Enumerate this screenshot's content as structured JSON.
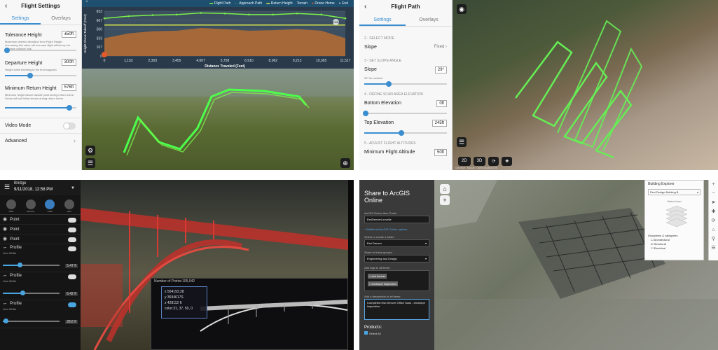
{
  "flight_settings": {
    "title": "Flight Settings",
    "tabs": [
      "Settings",
      "Overlays"
    ],
    "tolerance": {
      "label": "Tolerance Height",
      "value": "±50ft",
      "desc": "Maximum desired deviation from Flight Height. Increasing this value will increase flight efficiency but increase collision risk.",
      "level": 0.03
    },
    "departure": {
      "label": "Departure Height",
      "value": "300ft",
      "desc": "Height while traveling to the first waypoint.",
      "level": 0.35
    },
    "min_return": {
      "label": "Minimum Return Height",
      "value": "576ft",
      "desc": "Minimum height above takeoff point during return home. Drone will not follow terrain during return home.",
      "level": 0.9
    },
    "video_mode": {
      "label": "Video Mode",
      "on": false
    },
    "advanced": {
      "label": "Advanced"
    },
    "chart_legend": [
      "Flight Path",
      "Approach Path",
      "Return Height",
      "Terrain",
      "Drone Home",
      "End"
    ],
    "ylabel": "Height Above Takeoff (Feet)",
    "xlabel": "Distance Traveled (Feet)",
    "end_badge": "END"
  },
  "chart_data": {
    "type": "area",
    "x": [
      0,
      1152,
      2303,
      3455,
      4607,
      5758,
      6910,
      8062,
      9213,
      10365,
      11517
    ],
    "xticks": [
      "0",
      "1,152",
      "2,303",
      "3,455",
      "4,607",
      "5,758",
      "6,910",
      "8,062",
      "9,213",
      "10,365",
      "11,517"
    ],
    "yticks": [
      "833",
      "667",
      "500",
      "333",
      "167",
      "0"
    ],
    "ylim": [
      0,
      833
    ],
    "series": [
      {
        "name": "Terrain",
        "values": [
          330,
          420,
          460,
          470,
          520,
          500,
          470,
          480,
          500,
          470,
          330
        ]
      },
      {
        "name": "Flight Path",
        "values": [
          700,
          740,
          760,
          770,
          800,
          790,
          770,
          770,
          790,
          770,
          700
        ]
      },
      {
        "name": "Return Height",
        "values": [
          576,
          576,
          576,
          576,
          576,
          576,
          576,
          576,
          576,
          576,
          576
        ]
      }
    ],
    "xlabel": "Distance Traveled (Feet)",
    "ylabel": "Height Above Takeoff (Feet)"
  },
  "flight_path": {
    "title": "Flight Path",
    "tabs": [
      "Settings",
      "Overlays"
    ],
    "sec2": "2 - SELECT MODE",
    "slope_mode": {
      "label": "Slope",
      "value": "Fixed"
    },
    "sec3": "3 - SET SLOPE ANGLE",
    "slope_angle": {
      "label": "Slope",
      "value": "29°",
      "desc": "90° for vertical",
      "level": 0.3
    },
    "sec4": "4 - DEFINE SCAN AREA ELEVATION",
    "bottom_elev": {
      "label": "Bottom Elevation",
      "value": "0ft",
      "level": 0.02
    },
    "top_elev": {
      "label": "Top Elevation",
      "value": "245ft",
      "level": 0.45
    },
    "sec5": "5 - ADJUST FLIGHT ALTITUDES",
    "min_alt": {
      "label": "Minimum Flight Altitude",
      "value": "50ft"
    },
    "mode_buttons": [
      "2D",
      "3D"
    ],
    "attribution": "GeoEye, Maxar, CNES/Airbus DS"
  },
  "pointcloud": {
    "title": "Bridge",
    "subtitle": "9/11/2018, 12:58 PM",
    "modes": [
      "RGB",
      "Intensity",
      "Class",
      "Elev"
    ],
    "points": [
      "Point",
      "Point",
      "Point"
    ],
    "profiles": [
      {
        "name": "Profile",
        "sub": "Line Width",
        "value": "5.47 ft",
        "on": false,
        "level": 0.3
      },
      {
        "name": "Profile",
        "sub": "Line Width",
        "value": "6.42 ft",
        "on": false,
        "level": 0.35
      },
      {
        "name": "Profile",
        "sub": "Line Width",
        "value": "28.8 ft",
        "on": true,
        "level": 0.05
      }
    ],
    "inset_header": "Number of Points:105,042",
    "tooltip": [
      "x  504193.28",
      "y  3694617S",
      "z  428112 ft",
      "color:31, 37, 50, 0"
    ]
  },
  "share": {
    "title": "Share to ArcGIS Online",
    "item_prefix_label": "ArcGIS Online Item Prefix:",
    "item_prefix_value": "EsriDenverLouvelle",
    "link": "+ Additional ArcGIS Online options",
    "folder_label": "Select or create a folder:",
    "folder_value": "Esri Denver",
    "groups_label": "Share to these groups:",
    "groups_value": "Engineering and Design",
    "tags_label": "Add tags to all items:",
    "tags": [
      "× esri denver",
      "× envelope inspection"
    ],
    "desc_label": "Add a description to all items:",
    "desc_value": "Completed Esri Denver Office Scan - envelope inspection",
    "products": "Products:",
    "select_all": "Select All"
  },
  "building_explorer": {
    "title": "Building Explorer",
    "floor_select": "First Design Building B",
    "select_level": "Select level",
    "disciplines": "Disciplines & categories",
    "items": [
      "Architectural",
      "Structural",
      "Electrical"
    ]
  }
}
